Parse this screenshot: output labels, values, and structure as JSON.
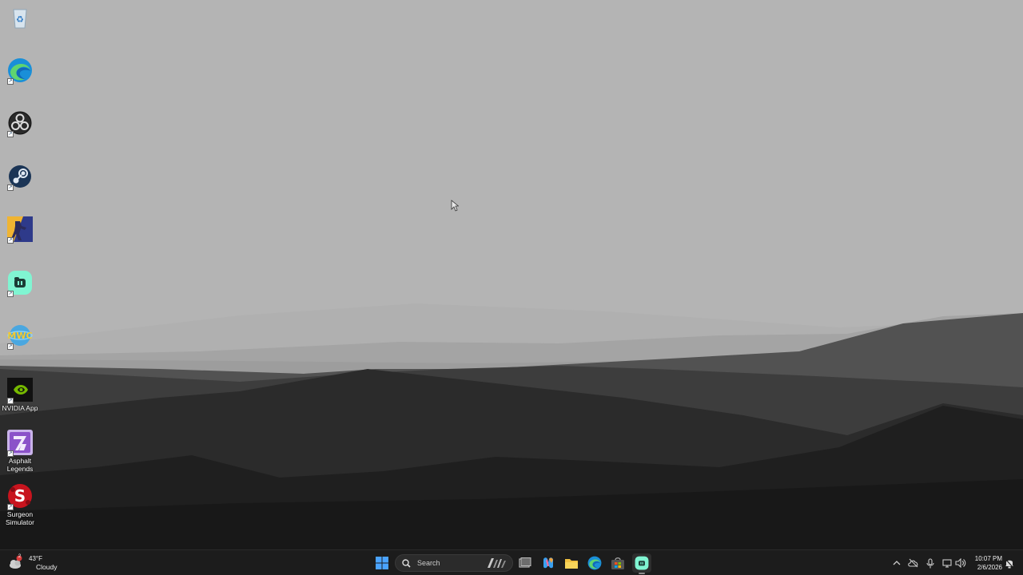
{
  "desktop": {
    "icons": [
      {
        "name": "Recycle Bin",
        "label": "",
        "icon": "recycle-bin-icon"
      },
      {
        "name": "Microsoft Edge",
        "label": "",
        "icon": "edge-icon"
      },
      {
        "name": "OBS Studio",
        "label": "",
        "icon": "obs-icon"
      },
      {
        "name": "Steam",
        "label": "",
        "icon": "steam-icon"
      },
      {
        "name": "Counter-Strike",
        "label": "",
        "icon": "counter-strike-icon"
      },
      {
        "name": "Streamlabs",
        "label": "",
        "icon": "streamlabs-icon"
      },
      {
        "name": "MWC",
        "label": "",
        "icon": "mwc-icon"
      },
      {
        "name": "NVIDIA App",
        "label": "NVIDIA App",
        "icon": "nvidia-icon"
      },
      {
        "name": "Asphalt Legends",
        "label": "Asphalt\nLegends",
        "icon": "asphalt-legends-icon"
      },
      {
        "name": "Surgeon Simulator",
        "label": "Surgeon\nSimulator",
        "icon": "surgeon-simulator-icon"
      }
    ]
  },
  "taskbar": {
    "weather": {
      "temp": "43°F",
      "condition": "Cloudy",
      "badge": "2"
    },
    "search": {
      "placeholder": "Search"
    },
    "pinned": [
      "start-button",
      "task-view-button",
      "copilot-button",
      "file-explorer-button",
      "edge-button",
      "store-button",
      "streamlabs-button"
    ],
    "clock": {
      "time": "10:07 PM",
      "date": "2/6/2026"
    }
  },
  "colors": {
    "taskbar_bg": "#1c1c1c",
    "sky": "#b4b4b4",
    "accent_blue": "#4aa3ff",
    "streamlabs_teal": "#80f5d2"
  }
}
